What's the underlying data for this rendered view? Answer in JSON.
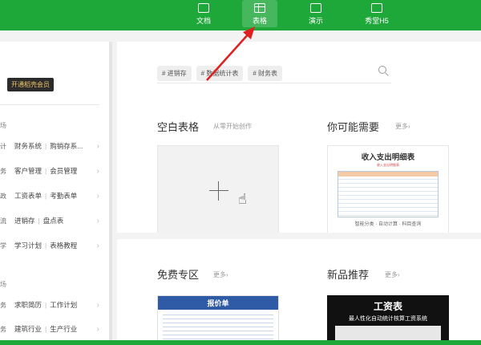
{
  "topbar": {
    "tabs": [
      {
        "label": "文档",
        "icon": "document-icon"
      },
      {
        "label": "表格",
        "icon": "spreadsheet-icon"
      },
      {
        "label": "演示",
        "icon": "presentation-icon"
      },
      {
        "label": "秀堂H5",
        "icon": "h5-icon"
      }
    ],
    "active_tab": "表格",
    "accent_color": "#1ea83a"
  },
  "sidebar": {
    "vip_button": "开通稻壳会员",
    "group1_frag": "场",
    "items": [
      {
        "frag": "计",
        "a": "财务系统",
        "b": "购销存系..."
      },
      {
        "frag": "务",
        "a": "客户管理",
        "b": "会员管理"
      },
      {
        "frag": "政",
        "a": "工资表单",
        "b": "考勤表单"
      },
      {
        "frag": "流",
        "a": "进销存",
        "b": "盘点表"
      },
      {
        "frag": "学",
        "a": "学习计划",
        "b": "表格教程"
      }
    ],
    "group2_frag": "场",
    "items2": [
      {
        "frag": "务",
        "a": "求职简历",
        "b": "工作计划"
      },
      {
        "frag": "务",
        "a": "建筑行业",
        "b": "生产行业"
      }
    ]
  },
  "main": {
    "tags": [
      "# 进销存",
      "# 数据统计表",
      "# 财务表"
    ],
    "blank": {
      "title": "空白表格",
      "sub": "从零开始创作"
    },
    "maybe": {
      "title": "你可能需要",
      "more": "更多›"
    },
    "maybe_template": {
      "title": "收入支出明细表",
      "mini": "收入支出明细表",
      "foot": "智能分类 · 自动计算 · 科目查询"
    },
    "free": {
      "title": "免费专区",
      "more": "更多›"
    },
    "free_template": {
      "head": "报价单"
    },
    "new": {
      "title": "新品推荐",
      "more": "更多›"
    },
    "new_template": {
      "t1": "工资表",
      "t2": "最人性化自动统计核算工资系统"
    }
  }
}
